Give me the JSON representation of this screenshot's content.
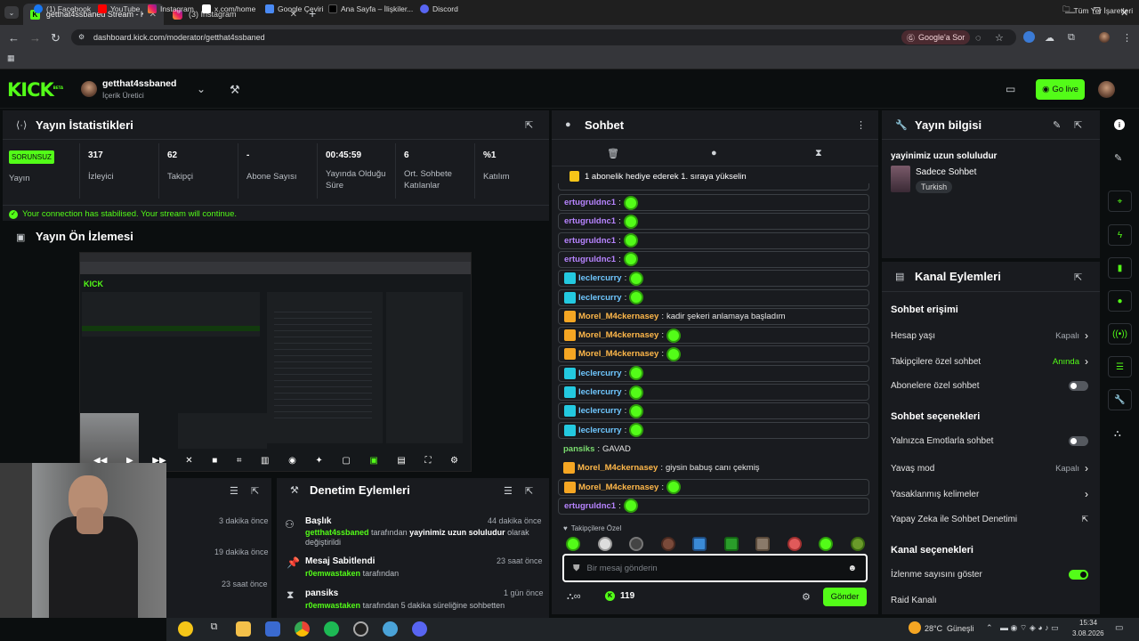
{
  "browser": {
    "tabs": [
      {
        "label": "getthat4ssbaned Stream - Kick"
      },
      {
        "label": "(3) Instagram"
      }
    ],
    "url": "dashboard.kick.com/moderator/getthat4ssbaned",
    "google_btn": "Google'a Sor",
    "bookmarks": [
      "(1) Facebook",
      "YouTube",
      "Instagram",
      "x.com/home",
      "Google Çeviri",
      "Ana Sayfa – İlişkiler...",
      "Discord"
    ],
    "bookmarks_right": "Tüm Yer İşaretleri"
  },
  "header": {
    "logo": "KICK",
    "logo_beta": "BETA",
    "channel": "getthat4ssbaned",
    "role": "İçerik Üretici",
    "go_live": "Go live"
  },
  "stats": {
    "title": "Yayın İstatistikleri",
    "status_badge": "SORUNSUZ",
    "status_label": "Yayın",
    "items": [
      {
        "value": "317",
        "label": "İzleyici"
      },
      {
        "value": "62",
        "label": "Takipçi"
      },
      {
        "value": "-",
        "label": "Abone Sayısı"
      },
      {
        "value": "00:45:59",
        "label": "Yayında Olduğu Süre"
      },
      {
        "value": "6",
        "label": "Ort. Sohbete Katılanlar"
      },
      {
        "value": "%1",
        "label": "Katılım"
      }
    ],
    "notice": "Your connection has stabilised. Your stream will continue."
  },
  "preview": {
    "title": "Yayın Ön İzlemesi"
  },
  "lower_left": {
    "times": [
      "3 dakika önce",
      "19 dakika önce",
      "23 saat önce"
    ]
  },
  "mod_actions": {
    "title": "Denetim Eylemleri",
    "items": [
      {
        "title": "Başlık",
        "time": "44 dakika önce",
        "actor": "getthat4ssbaned",
        "mid": "tarafından",
        "target": "yayinimiz uzun soluludur",
        "rest": "olarak değiştirildi"
      },
      {
        "title": "Mesaj Sabitlendi",
        "time": "23 saat önce",
        "actor": "r0emwastaken",
        "rest": "tarafından"
      },
      {
        "title": "pansiks",
        "time": "1 gün önce",
        "actor": "r0emwastaken",
        "rest": "tarafından 5 dakika süreliğine sohbetten"
      }
    ]
  },
  "chat": {
    "title": "Sohbet",
    "pinned": "1 abonelik hediye ederek 1. sıraya yükselin",
    "messages": [
      {
        "user": "ertugruldnc1",
        "color": "purple",
        "badge": "",
        "text": "",
        "emote": true
      },
      {
        "user": "ertugruldnc1",
        "color": "purple",
        "badge": "",
        "text": "",
        "emote": true
      },
      {
        "user": "ertugruldnc1",
        "color": "purple",
        "badge": "",
        "text": "",
        "emote": true
      },
      {
        "user": "ertugruldnc1",
        "color": "purple",
        "badge": "",
        "text": "",
        "emote": true
      },
      {
        "user": "leclercurry",
        "color": "blue",
        "badge": "tb",
        "text": "",
        "emote": true
      },
      {
        "user": "leclercurry",
        "color": "blue",
        "badge": "tb",
        "text": "",
        "emote": true
      },
      {
        "user": "Morel_M4ckernasey",
        "color": "orange",
        "badge": "crown",
        "text": "kadir şekeri anlamaya başladım",
        "emote": false
      },
      {
        "user": "Morel_M4ckernasey",
        "color": "orange",
        "badge": "crown",
        "text": "",
        "emote": true
      },
      {
        "user": "Morel_M4ckernasey",
        "color": "orange",
        "badge": "crown",
        "text": "",
        "emote": true
      },
      {
        "user": "leclercurry",
        "color": "blue",
        "badge": "tb",
        "text": "",
        "emote": true
      },
      {
        "user": "leclercurry",
        "color": "blue",
        "badge": "tb",
        "text": "",
        "emote": true
      },
      {
        "user": "leclercurry",
        "color": "blue",
        "badge": "tb",
        "text": "",
        "emote": true
      },
      {
        "user": "leclercurry",
        "color": "blue",
        "badge": "tb",
        "text": "",
        "emote": true
      },
      {
        "user": "pansiks",
        "color": "green",
        "badge": "",
        "text": "GAVAD",
        "emote": false,
        "plain": true
      },
      {
        "user": "Morel_M4ckernasey",
        "color": "orange",
        "badge": "crown",
        "text": "giysin babuş canı çekmiş",
        "emote": false,
        "plain": true
      },
      {
        "user": "Morel_M4ckernasey",
        "color": "orange",
        "badge": "crown",
        "text": "",
        "emote": true
      },
      {
        "user": "ertugruldnc1",
        "color": "purple",
        "badge": "",
        "text": "",
        "emote": true
      }
    ],
    "followers_only": "Takipçilere Özel",
    "input_placeholder": "Bir mesaj gönderin",
    "points": "119",
    "send": "Gönder"
  },
  "stream_info": {
    "title": "Yayın bilgisi",
    "stream_title": "yayinimiz uzun soluludur",
    "category": "Sadece Sohbet",
    "tag": "Turkish"
  },
  "channel_actions": {
    "title": "Kanal Eylemleri",
    "chat_access": "Sohbet erişimi",
    "rows1": [
      {
        "label": "Hesap yaşı",
        "value": "Kapalı",
        "type": "arrow"
      },
      {
        "label": "Takipçilere özel sohbet",
        "value": "Anında",
        "type": "arrow",
        "green": true
      },
      {
        "label": "Abonelere özel sohbet",
        "type": "toggle",
        "on": false
      }
    ],
    "chat_options": "Sohbet seçenekleri",
    "rows2": [
      {
        "label": "Yalnızca Emotlarla sohbet",
        "type": "toggle",
        "on": false
      },
      {
        "label": "Yavaş mod",
        "value": "Kapalı",
        "type": "arrow"
      },
      {
        "label": "Yasaklanmış kelimeler",
        "value": "",
        "type": "arrow"
      },
      {
        "label": "Yapay Zeka ile Sohbet Denetimi",
        "value": "",
        "type": "ext"
      }
    ],
    "channel_options": "Kanal seçenekleri",
    "rows3": [
      {
        "label": "İzlenme sayısını göster",
        "type": "toggle",
        "on": true
      },
      {
        "label": "Raid Kanalı",
        "type": "none"
      }
    ]
  },
  "taskbar": {
    "weather": "28°C",
    "weather_label": "Güneşli",
    "time": "15:34",
    "date": "3.08.2026"
  }
}
